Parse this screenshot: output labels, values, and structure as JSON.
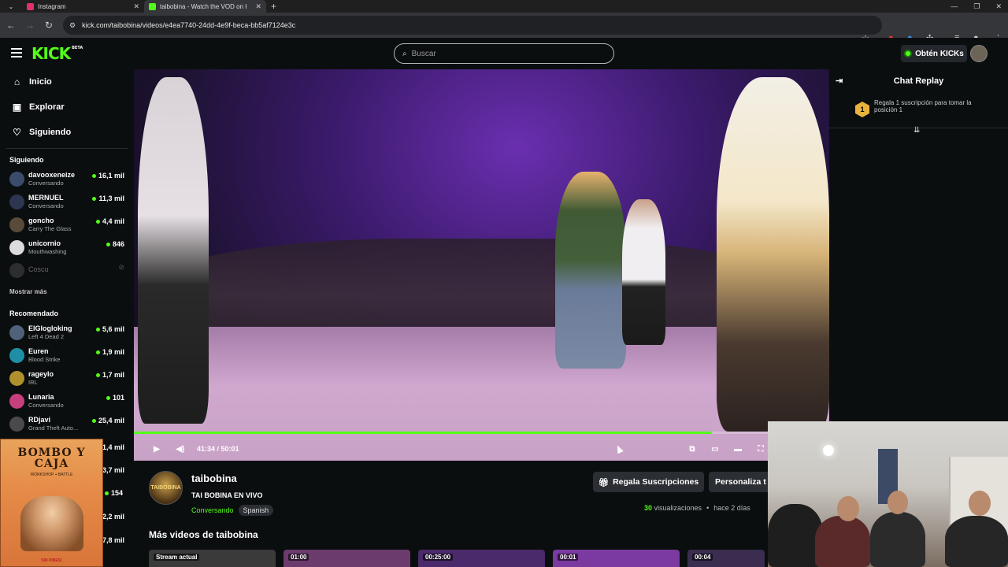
{
  "browser": {
    "tabs": [
      {
        "label": "Instagram",
        "active": false,
        "color": "#e1306c"
      },
      {
        "label": "taibobina - Watch the VOD on Kick",
        "active": true,
        "color": "#53fc18"
      }
    ],
    "url": "kick.com/taibobina/videos/e4ea7740-24dd-4e9f-beca-bb5af7124e3c"
  },
  "header": {
    "logo": "KICK",
    "logo_badge": "BETA",
    "search_placeholder": "Buscar",
    "kicks_button": "Obtén KICKs"
  },
  "sidebar": {
    "nav": [
      {
        "label": "Inicio",
        "icon": "home-icon"
      },
      {
        "label": "Explorar",
        "icon": "compass-icon"
      },
      {
        "label": "Siguiendo",
        "icon": "heart-icon"
      }
    ],
    "following_title": "Siguiendo",
    "following": [
      {
        "name": "davooxeneize",
        "category": "Conversando",
        "viewers": "16,1 mil",
        "color": "#3b4b6b"
      },
      {
        "name": "MERNUEL",
        "category": "Conversando",
        "viewers": "11,3 mil",
        "color": "#2d3550"
      },
      {
        "name": "goncho",
        "category": "Carry The Glass",
        "viewers": "4,4 mil",
        "color": "#5a4a3a"
      },
      {
        "name": "unicornio",
        "category": "Mouthwashing",
        "viewers": "846",
        "color": "#dcdcdc"
      },
      {
        "name": "Coscu",
        "category": "",
        "viewers": "",
        "color": "#444444",
        "offline": true
      }
    ],
    "show_more": "Mostrar más",
    "recommended_title": "Recomendado",
    "recommended": [
      {
        "name": "ElGlogloking",
        "category": "Left 4 Dead 2",
        "viewers": "5,6 mil",
        "color": "#50617a"
      },
      {
        "name": "Euren",
        "category": "Blood Strike",
        "viewers": "1,9 mil",
        "color": "#1f8fa8"
      },
      {
        "name": "rageylo",
        "category": "IRL",
        "viewers": "1,7 mil",
        "color": "#b0902c"
      },
      {
        "name": "Lunaria",
        "category": "Conversando",
        "viewers": "101",
        "color": "#c73f7c"
      },
      {
        "name": "RDjavi",
        "category": "Grand Theft Auto...",
        "viewers": "25,4 mil",
        "color": "#4a4a4a"
      }
    ],
    "hidden_viewers": [
      "1,4 mil",
      "3,7 mil",
      "154",
      "2,2 mil",
      "7,8 mil"
    ]
  },
  "player": {
    "time": "41:34 / 50:01",
    "progress": 0.831,
    "accent": "#53fc18"
  },
  "chat": {
    "title": "Chat Replay",
    "gift_rank": "1",
    "gift_text": "Regala 1 suscripción para tomar la posición 1"
  },
  "channel": {
    "name": "taibobina",
    "avatar_text": "TAIBOBINA",
    "stream_title": "TAI BOBINA EN VIVO",
    "category": "Conversando",
    "tag": "Spanish",
    "gift_button": "Regala Suscripciones",
    "customize_button": "Personaliza t",
    "views_count": "30",
    "views_label": "visualizaciones",
    "posted": "hace 2 días"
  },
  "more_videos": {
    "title": "Más videos de taibobina",
    "thumbs": [
      {
        "label": "Stream actual",
        "color": "#3a3a3a"
      },
      {
        "label": "01:00",
        "color": "#6b3b6e"
      },
      {
        "label": "00:25:00",
        "color": "#4a2a6a"
      },
      {
        "label": "00:01",
        "color": "#7a3aa0"
      },
      {
        "label": "00:04",
        "color": "#3a2d50"
      }
    ]
  },
  "poster": {
    "title_line1": "BOMBO Y",
    "title_line2": "CAJA",
    "subtitle": "WORKSHOP + BATTLE",
    "footer": "SIN PIBES!"
  }
}
